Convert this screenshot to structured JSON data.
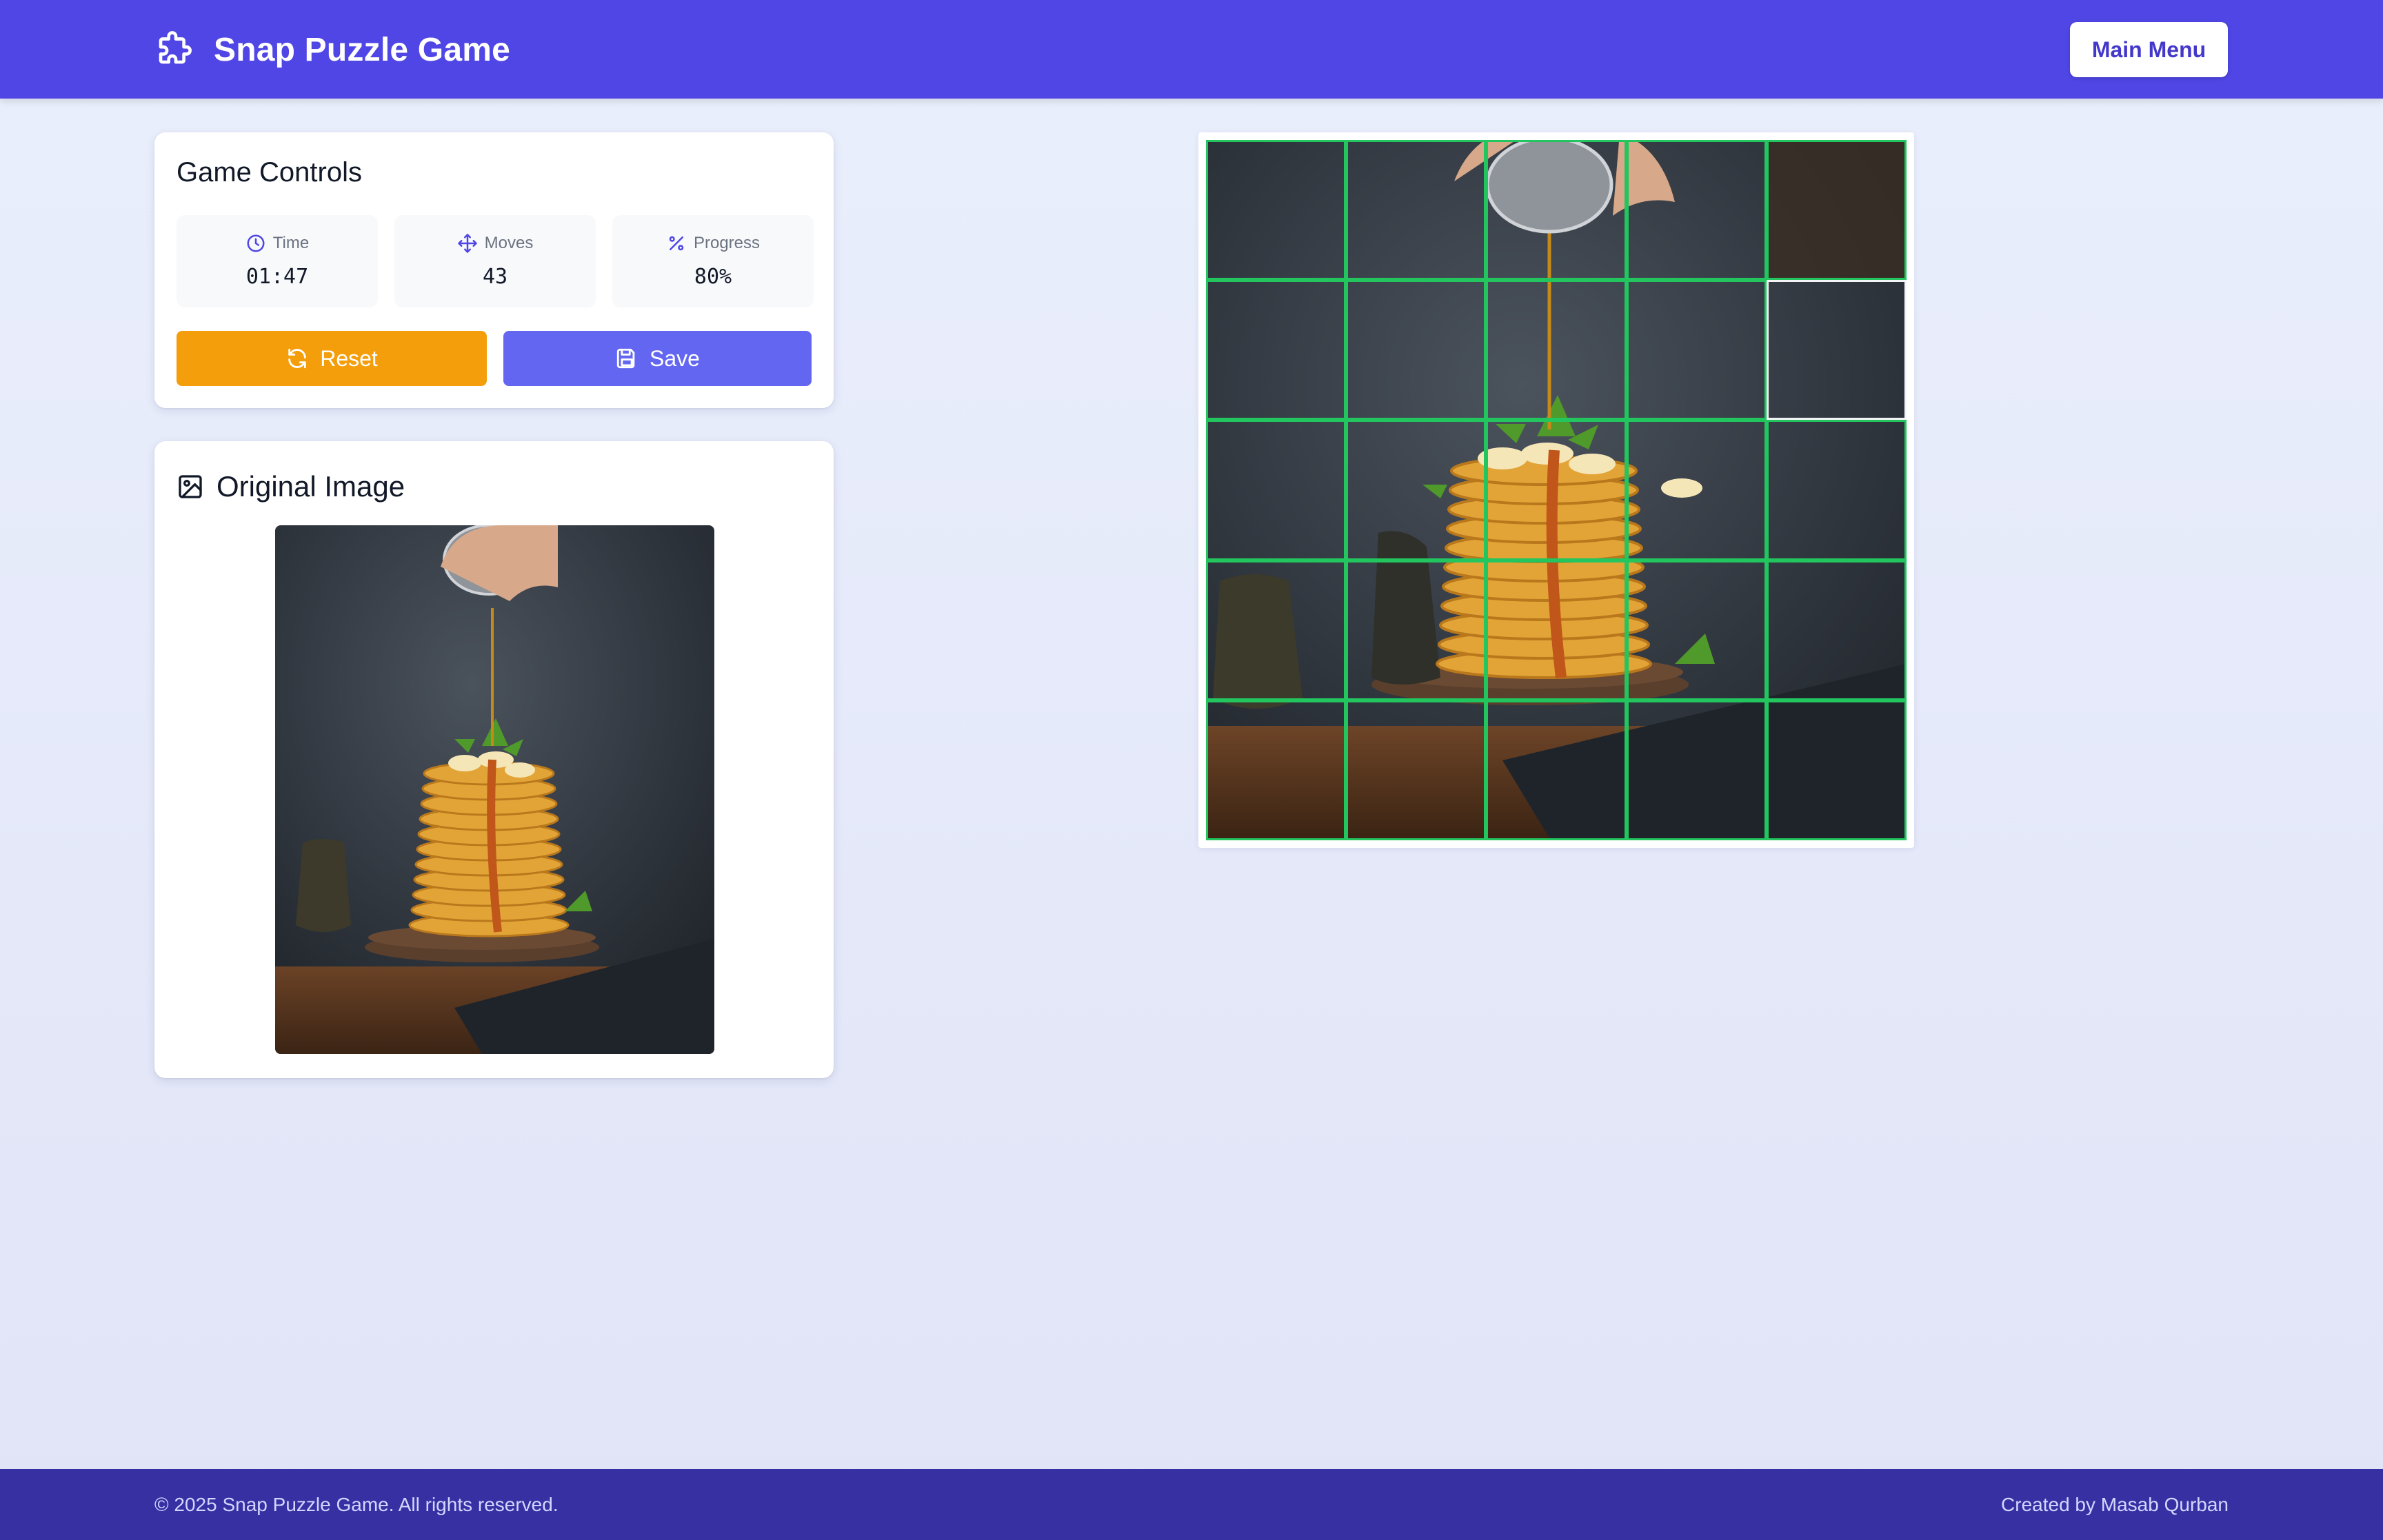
{
  "header": {
    "title": "Snap Puzzle Game",
    "logo_icon": "puzzle-piece-icon",
    "main_menu_label": "Main Menu"
  },
  "controls": {
    "title": "Game Controls",
    "stats": {
      "time": {
        "label": "Time",
        "value": "01:47",
        "icon": "clock-icon"
      },
      "moves": {
        "label": "Moves",
        "value": "43",
        "icon": "move-arrows-icon"
      },
      "progress": {
        "label": "Progress",
        "value": "80%",
        "icon": "percent-icon"
      }
    },
    "reset_label": "Reset",
    "save_label": "Save"
  },
  "original": {
    "title": "Original Image",
    "icon": "image-icon"
  },
  "board": {
    "rows": 5,
    "cols": 5,
    "progress_fraction": 0.8,
    "tiles_out_of_place": [
      9
    ]
  },
  "footer": {
    "copyright": "© 2025 Snap Puzzle Game. All rights reserved.",
    "credit": "Created by Masab Qurban"
  },
  "colors": {
    "header_bg": "#4f46e5",
    "footer_bg": "#3730a3",
    "reset_bg": "#f59e0b",
    "save_bg": "#6366f1",
    "correct_tile_border": "#22c55e",
    "wrong_tile_border": "#f3f4f6"
  }
}
